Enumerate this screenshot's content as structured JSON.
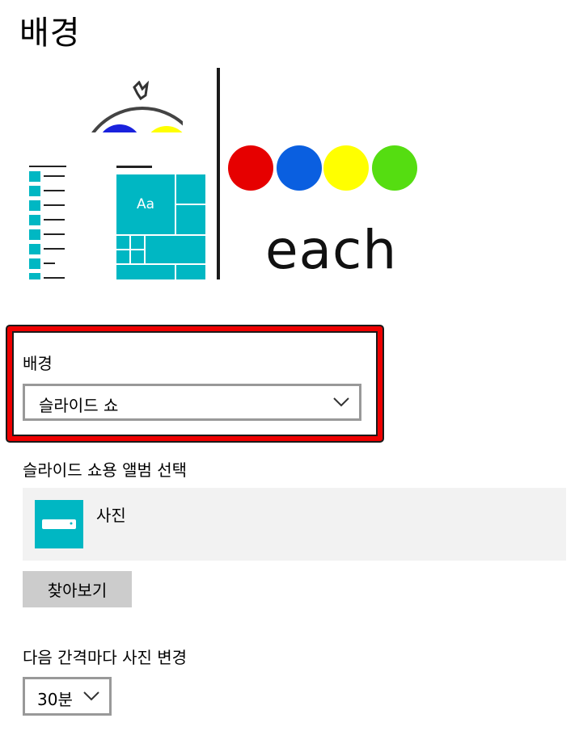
{
  "page": {
    "title": "배경"
  },
  "preview": {
    "sample_text": "each",
    "tile_text": "Aa",
    "colors": {
      "red": "#e60000",
      "blue": "#0a5fe0",
      "yellow": "#ffff00",
      "green": "#55dd11",
      "accent": "#00b7c3"
    }
  },
  "background": {
    "label": "배경",
    "selected": "슬라이드 쇼"
  },
  "album": {
    "label": "슬라이드 쇼용 앨범 선택",
    "name": "사진",
    "icon": "folder-icon"
  },
  "browse": {
    "label": "찾아보기"
  },
  "interval": {
    "label": "다음 간격마다 사진 변경",
    "selected": "30분"
  }
}
